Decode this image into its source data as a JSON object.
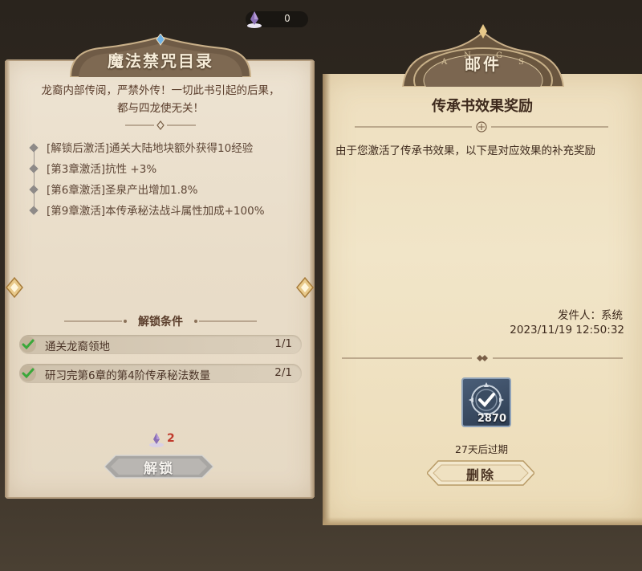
{
  "currency": {
    "icon": "crystal-icon",
    "amount": "0"
  },
  "left_panel": {
    "title": "魔法禁咒目录",
    "intro_line1": "龙裔内部传阅，严禁外传！一切此书引起的后果，",
    "intro_line2": "都与四龙使无关！",
    "effects": [
      "[解锁后激活]通关大陆地块额外获得10经验",
      "[第3章激活]抗性 +3%",
      "[第6章激活]圣泉产出增加1.8%",
      "[第9章激活]本传承秘法战斗属性加成+100%"
    ],
    "conditions_title": "解锁条件",
    "conditions": [
      {
        "label": "通关龙裔领地",
        "progress": "1/1"
      },
      {
        "label": "研习完第6章的第4阶传承秘法数量",
        "progress": "2/1"
      }
    ],
    "cost": {
      "icon": "crystal-icon",
      "amount": "2"
    },
    "unlock_label": "解锁"
  },
  "right_panel": {
    "title": "邮件",
    "compass_letters": "A N G S",
    "mail_title": "传承书效果奖励",
    "body": "由于您激活了传承书效果，以下是对应效果的补充奖励",
    "sender": "发件人：系统",
    "date": "2023/11/19 12:50:32",
    "attachment": {
      "icon": "checkmark-emblem-icon",
      "quantity": "2870"
    },
    "expire": "27天后过期",
    "delete_label": "删除"
  },
  "colors": {
    "paper": "#ecdcb8",
    "text_brown": "#5a3d2b",
    "check_green": "#3aa83a",
    "cost_red": "#c0392b"
  }
}
